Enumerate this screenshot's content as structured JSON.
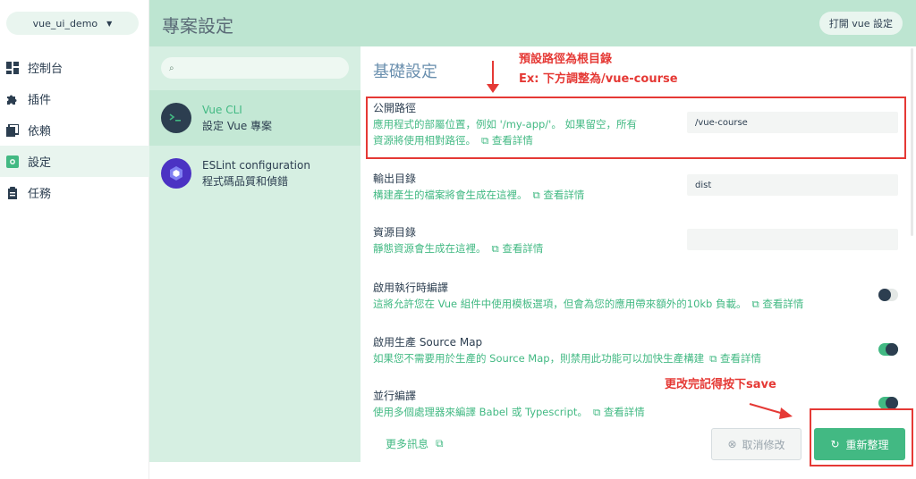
{
  "sidebar": {
    "project_name": "vue_ui_demo",
    "items": [
      {
        "label": "控制台",
        "icon": "dashboard-icon"
      },
      {
        "label": "插件",
        "icon": "puzzle-icon"
      },
      {
        "label": "依賴",
        "icon": "dependencies-icon"
      },
      {
        "label": "設定",
        "icon": "settings-icon"
      },
      {
        "label": "任務",
        "icon": "tasks-icon"
      }
    ]
  },
  "header": {
    "title": "專案設定",
    "open_button": "打開 vue 設定"
  },
  "plugins": [
    {
      "name": "Vue CLI",
      "desc": "設定 Vue 專案"
    },
    {
      "name": "ESLint configuration",
      "desc": "程式碼品質和偵錯"
    }
  ],
  "main": {
    "section_title": "基礎設定",
    "more_link": "查看詳情",
    "settings": [
      {
        "label": "公開路徑",
        "desc1": "應用程式的部屬位置，例如 '/my-app/'。 如果留空，所有",
        "desc2": "資源將使用相對路徑。",
        "value": "/vue-course"
      },
      {
        "label": "輸出目錄",
        "desc1": "構建產生的檔案將會生成在這裡。",
        "value": "dist"
      },
      {
        "label": "資源目錄",
        "desc1": "靜態資源會生成在這裡。",
        "value": ""
      },
      {
        "label": "啟用執行時編譯",
        "desc1": "這將允許您在 Vue 組件中使用模板選項，但會為您的應用帶來額外的10kb 負載。",
        "toggle": false
      },
      {
        "label": "啟用生產 Source Map",
        "desc1": "如果您不需要用於生產的 Source Map，則禁用此功能可以加快生產構建",
        "toggle": true
      },
      {
        "label": "並行編譯",
        "desc1": "使用多個處理器來編譯 Babel 或 Typescript。",
        "toggle": true
      }
    ],
    "footer_more": "更多訊息",
    "cancel_label": "取消修改",
    "save_label": "重新整理"
  },
  "annotations": {
    "note1_line1": "預設路徑為根目錄",
    "note1_line2": "Ex: 下方調整為/vue-course",
    "note2": "更改完記得按下save"
  },
  "colors": {
    "accent": "#42b983",
    "header": "#bde5d1",
    "annotation": "#e53935"
  }
}
